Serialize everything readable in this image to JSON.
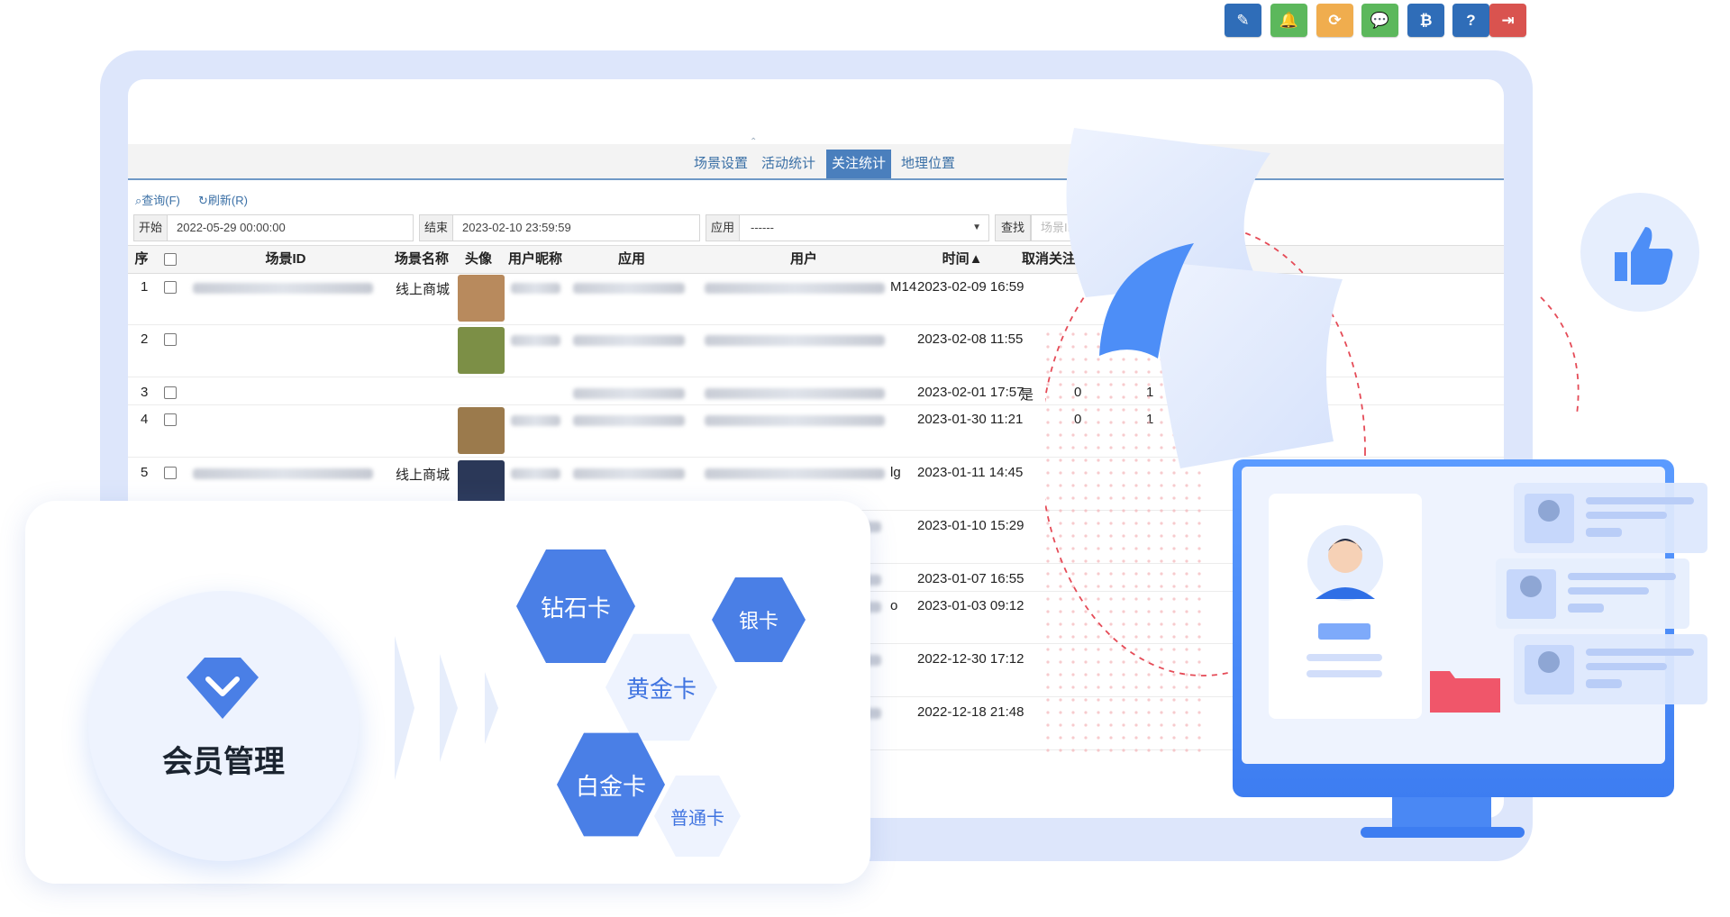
{
  "toolbar": {
    "buttons": [
      {
        "name": "edit-icon",
        "glyph": "✎",
        "color": "#2f6db8"
      },
      {
        "name": "bell-icon",
        "glyph": "🔔",
        "color": "#5cb85c"
      },
      {
        "name": "refresh-icon",
        "glyph": "⟳",
        "color": "#f0ad4e"
      },
      {
        "name": "wechat-icon",
        "glyph": "💬",
        "color": "#5cb85c"
      },
      {
        "name": "bitcoin-icon",
        "glyph": "₿",
        "color": "#2f6db8"
      },
      {
        "name": "help-icon",
        "glyph": "?",
        "color": "#2f6db8"
      },
      {
        "name": "logout-icon",
        "glyph": "⇥",
        "color": "#d9534f"
      }
    ]
  },
  "tabs": [
    "场景设置",
    "活动统计",
    "关注统计",
    "地理位置"
  ],
  "active_tab": "关注统计",
  "actions": {
    "query": "查询(F)",
    "refresh": "刷新(R)"
  },
  "filters": {
    "start_label": "开始",
    "start_value": "2022-05-29 00:00:00",
    "end_label": "结束",
    "end_value": "2023-02-10 23:59:59",
    "app_label": "应用",
    "app_value": "------",
    "find_label": "查找",
    "scene_placeholder": "场景II"
  },
  "table": {
    "headers": [
      "序",
      "场景ID",
      "场景名称",
      "头像",
      "用户昵称",
      "应用",
      "用户",
      "时间▲",
      "取消关注"
    ],
    "rows": [
      {
        "idx": "1",
        "scene_name": "线上商城",
        "user_suffix": "M14",
        "time": "2023-02-09 16:59",
        "cancel": "",
        "c1": "",
        "c2": ""
      },
      {
        "idx": "2",
        "scene_name": "",
        "user_suffix": "",
        "time": "2023-02-08 11:55",
        "cancel": "",
        "c1": "",
        "c2": ""
      },
      {
        "idx": "3",
        "scene_name": "",
        "user_suffix": "",
        "time": "2023-02-01 17:57",
        "cancel": "是",
        "c1": "0",
        "c2": "1"
      },
      {
        "idx": "4",
        "scene_name": "",
        "user_suffix": "",
        "time": "2023-01-30 11:21",
        "cancel": "",
        "c1": "0",
        "c2": "1"
      },
      {
        "idx": "5",
        "scene_name": "线上商城",
        "user_suffix": "lg",
        "time": "2023-01-11 14:45",
        "cancel": "",
        "c1": "",
        "c2": ""
      },
      {
        "idx": "",
        "scene_name": "",
        "user_suffix": "",
        "time": "2023-01-10 15:29",
        "cancel": "",
        "c1": "",
        "c2": ""
      },
      {
        "idx": "",
        "scene_name": "",
        "user_suffix": "",
        "time": "2023-01-07 16:55",
        "cancel": "",
        "c1": "",
        "c2": ""
      },
      {
        "idx": "",
        "scene_name": "",
        "user_suffix": "o",
        "time": "2023-01-03 09:12",
        "cancel": "",
        "c1": "",
        "c2": ""
      },
      {
        "idx": "",
        "scene_name": "",
        "user_suffix": "",
        "time": "2022-12-30 17:12",
        "cancel": "",
        "c1": "",
        "c2": ""
      },
      {
        "idx": "",
        "scene_name": "",
        "user_suffix": "",
        "time": "2022-12-18 21:48",
        "cancel": "",
        "c1": "",
        "c2": ""
      }
    ]
  },
  "member": {
    "title": "会员管理",
    "cards": [
      "钻石卡",
      "银卡",
      "黄金卡",
      "白金卡",
      "普通卡"
    ]
  },
  "colors": {
    "accent": "#4a7fe6",
    "tab_active": "#4a7fbd",
    "frame": "#dde6fb"
  }
}
